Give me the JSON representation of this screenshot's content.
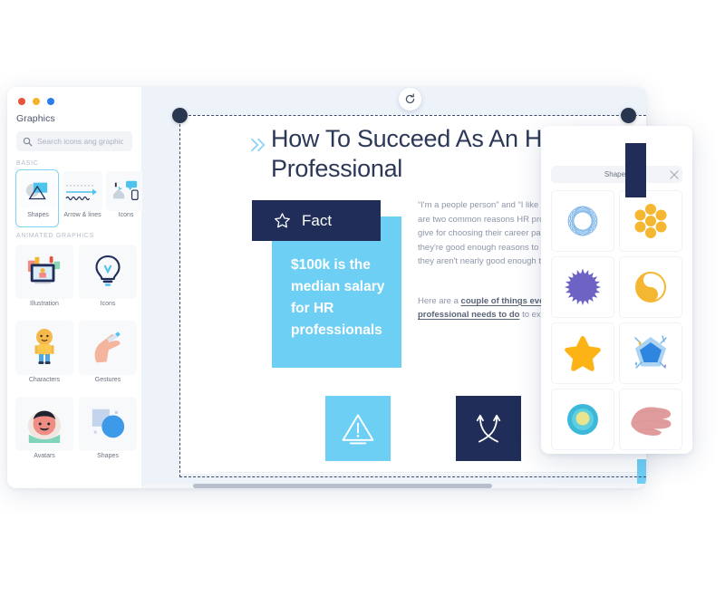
{
  "app": {
    "window_controls": [
      {
        "name": "close",
        "color": "#e8503a"
      },
      {
        "name": "minimize",
        "color": "#f5b32c"
      },
      {
        "name": "maximize",
        "color": "#2b7de9"
      }
    ]
  },
  "sidebar": {
    "title": "Graphics",
    "search": {
      "placeholder": "Search icons ang graphics",
      "value": "",
      "icon": "search-icon"
    },
    "sections": [
      {
        "label": "BASIC",
        "items": [
          {
            "label": "Shapes",
            "icon": "shapes-thumb-icon",
            "selected": true
          },
          {
            "label": "Arrow & lines",
            "icon": "arrow-lines-thumb-icon",
            "selected": false
          },
          {
            "label": "Icons",
            "icon": "icons-thumb-icon",
            "selected": false
          }
        ]
      },
      {
        "label": "ANIMATED GRAPHICS",
        "items": [
          {
            "label": "Illustration",
            "icon": "illustration-thumb-icon"
          },
          {
            "label": "Icons",
            "icon": "lightbulb-thumb-icon"
          },
          {
            "label": "Characters",
            "icon": "character-thumb-icon"
          },
          {
            "label": "Gestures",
            "icon": "gesture-hand-thumb-icon"
          },
          {
            "label": "Avatars",
            "icon": "avatar-thumb-icon"
          },
          {
            "label": "Shapes",
            "icon": "shapes-circle-thumb-icon"
          }
        ]
      }
    ]
  },
  "canvas": {
    "refresh_button_icon": "refresh-icon",
    "slide": {
      "chevron_icon": "double-chevron-right-icon",
      "title": "How To Succeed As An HR Professional",
      "fact_badge": {
        "icon": "star-outline-icon",
        "label": "Fact"
      },
      "stat_text": "$100k is the median salary for HR professionals",
      "paragraph_1": "“I'm a people person” and “I like helping others” are two common reasons HR professionals give for choosing their career path. While they're good enough reasons to get started, they aren't nearly good enough to be great.",
      "paragraph_2_pre": "Here are a ",
      "paragraph_2_link": "couple of things every HR professional needs to do",
      "paragraph_2_post": " to excel in the",
      "tiles": [
        {
          "icon": "warning-triangle-icon",
          "background": "#6ecff5"
        },
        {
          "icon": "crossing-arrows-icon",
          "background": "#1f2d58"
        }
      ]
    },
    "selection": {
      "handles": [
        "top-left-handle",
        "top-right-handle"
      ]
    }
  },
  "shapes_panel": {
    "title": "Shapes",
    "close_icon": "close-icon",
    "shapes": [
      {
        "name": "spirograph-ring-shape",
        "color": "#7fb6e8"
      },
      {
        "name": "dot-cluster-flower-shape",
        "color": "#f5b731"
      },
      {
        "name": "spiky-starburst-circle-shape",
        "color": "#6c63c4"
      },
      {
        "name": "yin-yang-crescent-shape",
        "color": "#f5b731"
      },
      {
        "name": "five-point-star-shape",
        "color": "#fbb315"
      },
      {
        "name": "pentagon-sparkle-shape",
        "color": "#2f86e0"
      },
      {
        "name": "concentric-circles-shape",
        "color": "#3bb8da"
      },
      {
        "name": "brush-stroke-shape",
        "color": "#e09c9c"
      }
    ]
  },
  "colors": {
    "navy": "#1f2d58",
    "sky": "#6ecff5",
    "canvas_bg": "#eef3fa",
    "heading": "#2c3857",
    "body_text": "#8e95a9",
    "accent_select": "#7fd3f7"
  }
}
